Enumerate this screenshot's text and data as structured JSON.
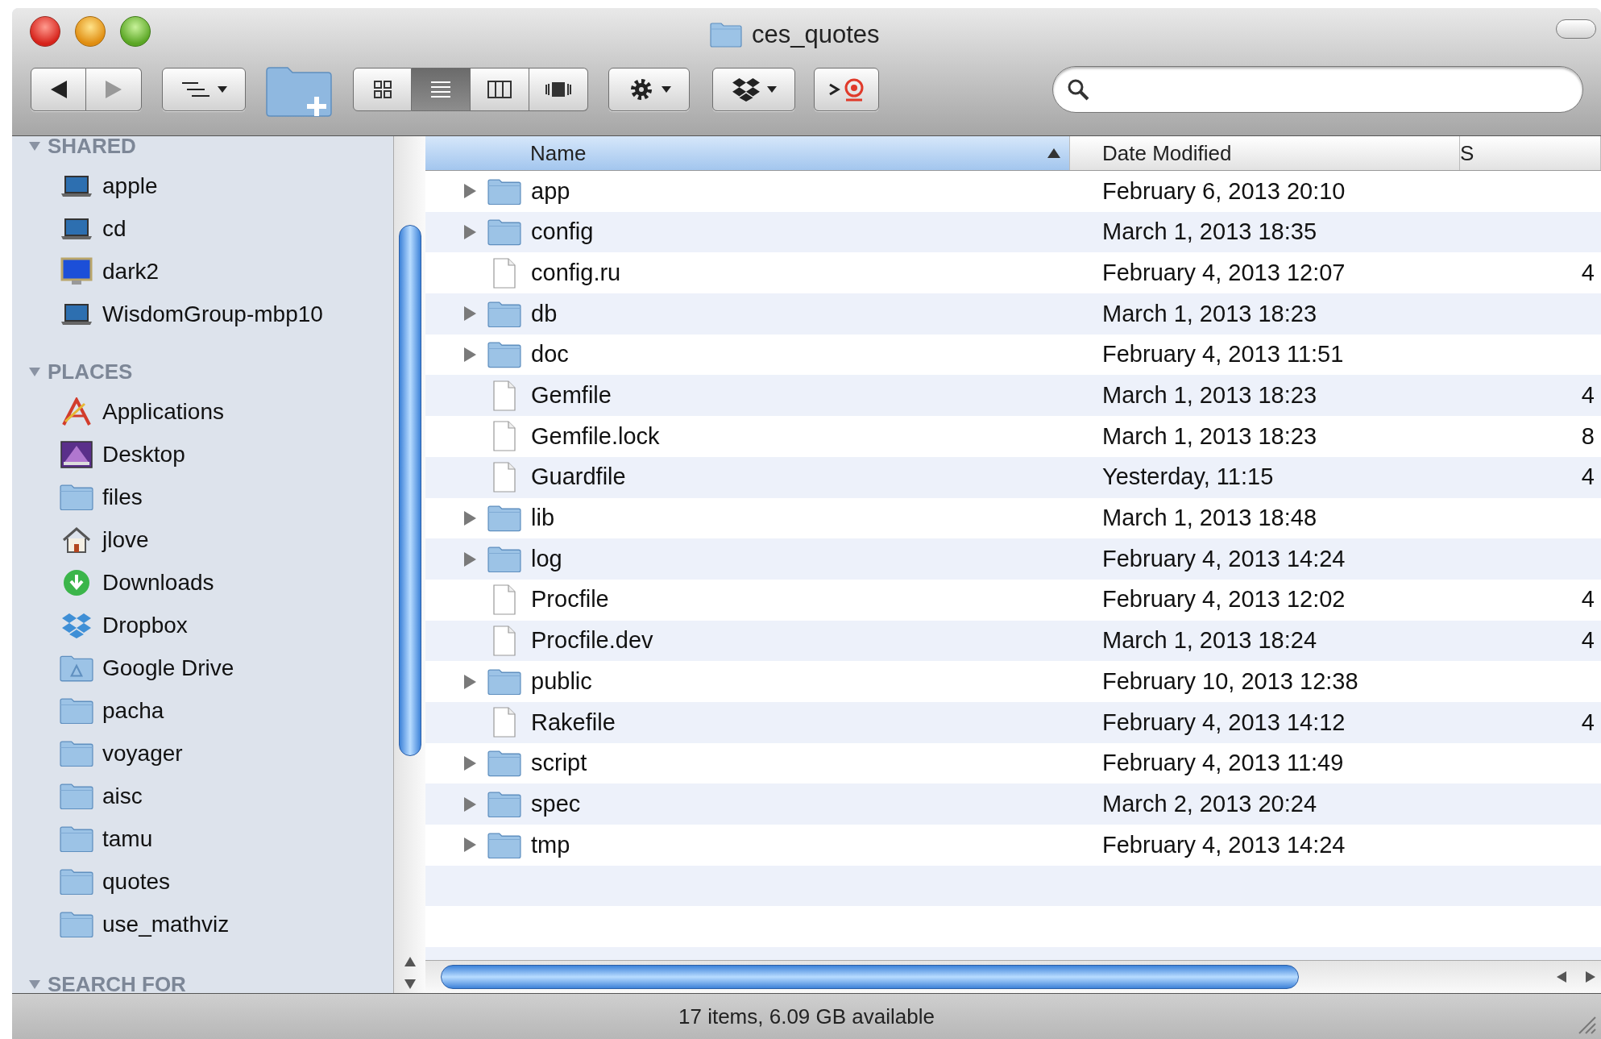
{
  "window": {
    "title": "ces_quotes"
  },
  "toolbar": {
    "view_modes": [
      {
        "kind": "icons",
        "selected": false
      },
      {
        "kind": "list",
        "selected": true
      },
      {
        "kind": "columns",
        "selected": false
      },
      {
        "kind": "coverflow",
        "selected": false
      }
    ]
  },
  "sidebar": {
    "sections": [
      {
        "title": "SHARED",
        "expanded": true,
        "items": [
          {
            "label": "apple",
            "kind": "laptop"
          },
          {
            "label": "cd",
            "kind": "laptop"
          },
          {
            "label": "dark2",
            "kind": "monitor"
          },
          {
            "label": "WisdomGroup-mbp10",
            "kind": "laptop"
          }
        ]
      },
      {
        "title": "PLACES",
        "expanded": true,
        "items": [
          {
            "label": "Applications",
            "kind": "applications"
          },
          {
            "label": "Desktop",
            "kind": "desktop"
          },
          {
            "label": "files",
            "kind": "folder"
          },
          {
            "label": "jlove",
            "kind": "home"
          },
          {
            "label": "Downloads",
            "kind": "downloads"
          },
          {
            "label": "Dropbox",
            "kind": "dropbox"
          },
          {
            "label": "Google Drive",
            "kind": "drive"
          },
          {
            "label": "pacha",
            "kind": "folder"
          },
          {
            "label": "voyager",
            "kind": "folder"
          },
          {
            "label": "aisc",
            "kind": "folder"
          },
          {
            "label": "tamu",
            "kind": "folder"
          },
          {
            "label": "quotes",
            "kind": "folder"
          },
          {
            "label": "use_mathviz",
            "kind": "folder"
          }
        ]
      },
      {
        "title": "SEARCH FOR",
        "expanded": true
      }
    ]
  },
  "table": {
    "columns": [
      {
        "label": "Name",
        "sorted": true
      },
      {
        "label": "Date Modified",
        "sorted": false
      },
      {
        "label": "S",
        "sorted": false
      }
    ],
    "rows": [
      {
        "name": "app",
        "kind": "folder",
        "expanded": false,
        "date": "February 6, 2013 20:10"
      },
      {
        "name": "config",
        "kind": "folder",
        "expanded": false,
        "date": "March 1, 2013 18:35"
      },
      {
        "name": "config.ru",
        "kind": "file",
        "date": "February 4, 2013 12:07",
        "size": "4"
      },
      {
        "name": "db",
        "kind": "folder",
        "expanded": false,
        "date": "March 1, 2013 18:23"
      },
      {
        "name": "doc",
        "kind": "folder",
        "expanded": false,
        "date": "February 4, 2013 11:51"
      },
      {
        "name": "Gemfile",
        "kind": "file",
        "date": "March 1, 2013 18:23",
        "size": "4"
      },
      {
        "name": "Gemfile.lock",
        "kind": "file",
        "date": "March 1, 2013 18:23",
        "size": "8"
      },
      {
        "name": "Guardfile",
        "kind": "file",
        "date": "Yesterday, 11:15",
        "size": "4"
      },
      {
        "name": "lib",
        "kind": "folder",
        "expanded": false,
        "date": "March 1, 2013 18:48"
      },
      {
        "name": "log",
        "kind": "folder",
        "expanded": false,
        "date": "February 4, 2013 14:24"
      },
      {
        "name": "Procfile",
        "kind": "file",
        "date": "February 4, 2013 12:02",
        "size": "4"
      },
      {
        "name": "Procfile.dev",
        "kind": "file",
        "date": "March 1, 2013 18:24",
        "size": "4"
      },
      {
        "name": "public",
        "kind": "folder",
        "expanded": false,
        "date": "February 10, 2013 12:38"
      },
      {
        "name": "Rakefile",
        "kind": "file",
        "date": "February 4, 2013 14:12",
        "size": "4"
      },
      {
        "name": "script",
        "kind": "folder",
        "expanded": false,
        "date": "February 4, 2013 11:49"
      },
      {
        "name": "spec",
        "kind": "folder",
        "expanded": false,
        "date": "March 2, 2013 20:24"
      },
      {
        "name": "tmp",
        "kind": "folder",
        "expanded": false,
        "date": "February 4, 2013 14:24"
      }
    ]
  },
  "status_bar": {
    "text": "17 items, 6.09 GB available"
  }
}
